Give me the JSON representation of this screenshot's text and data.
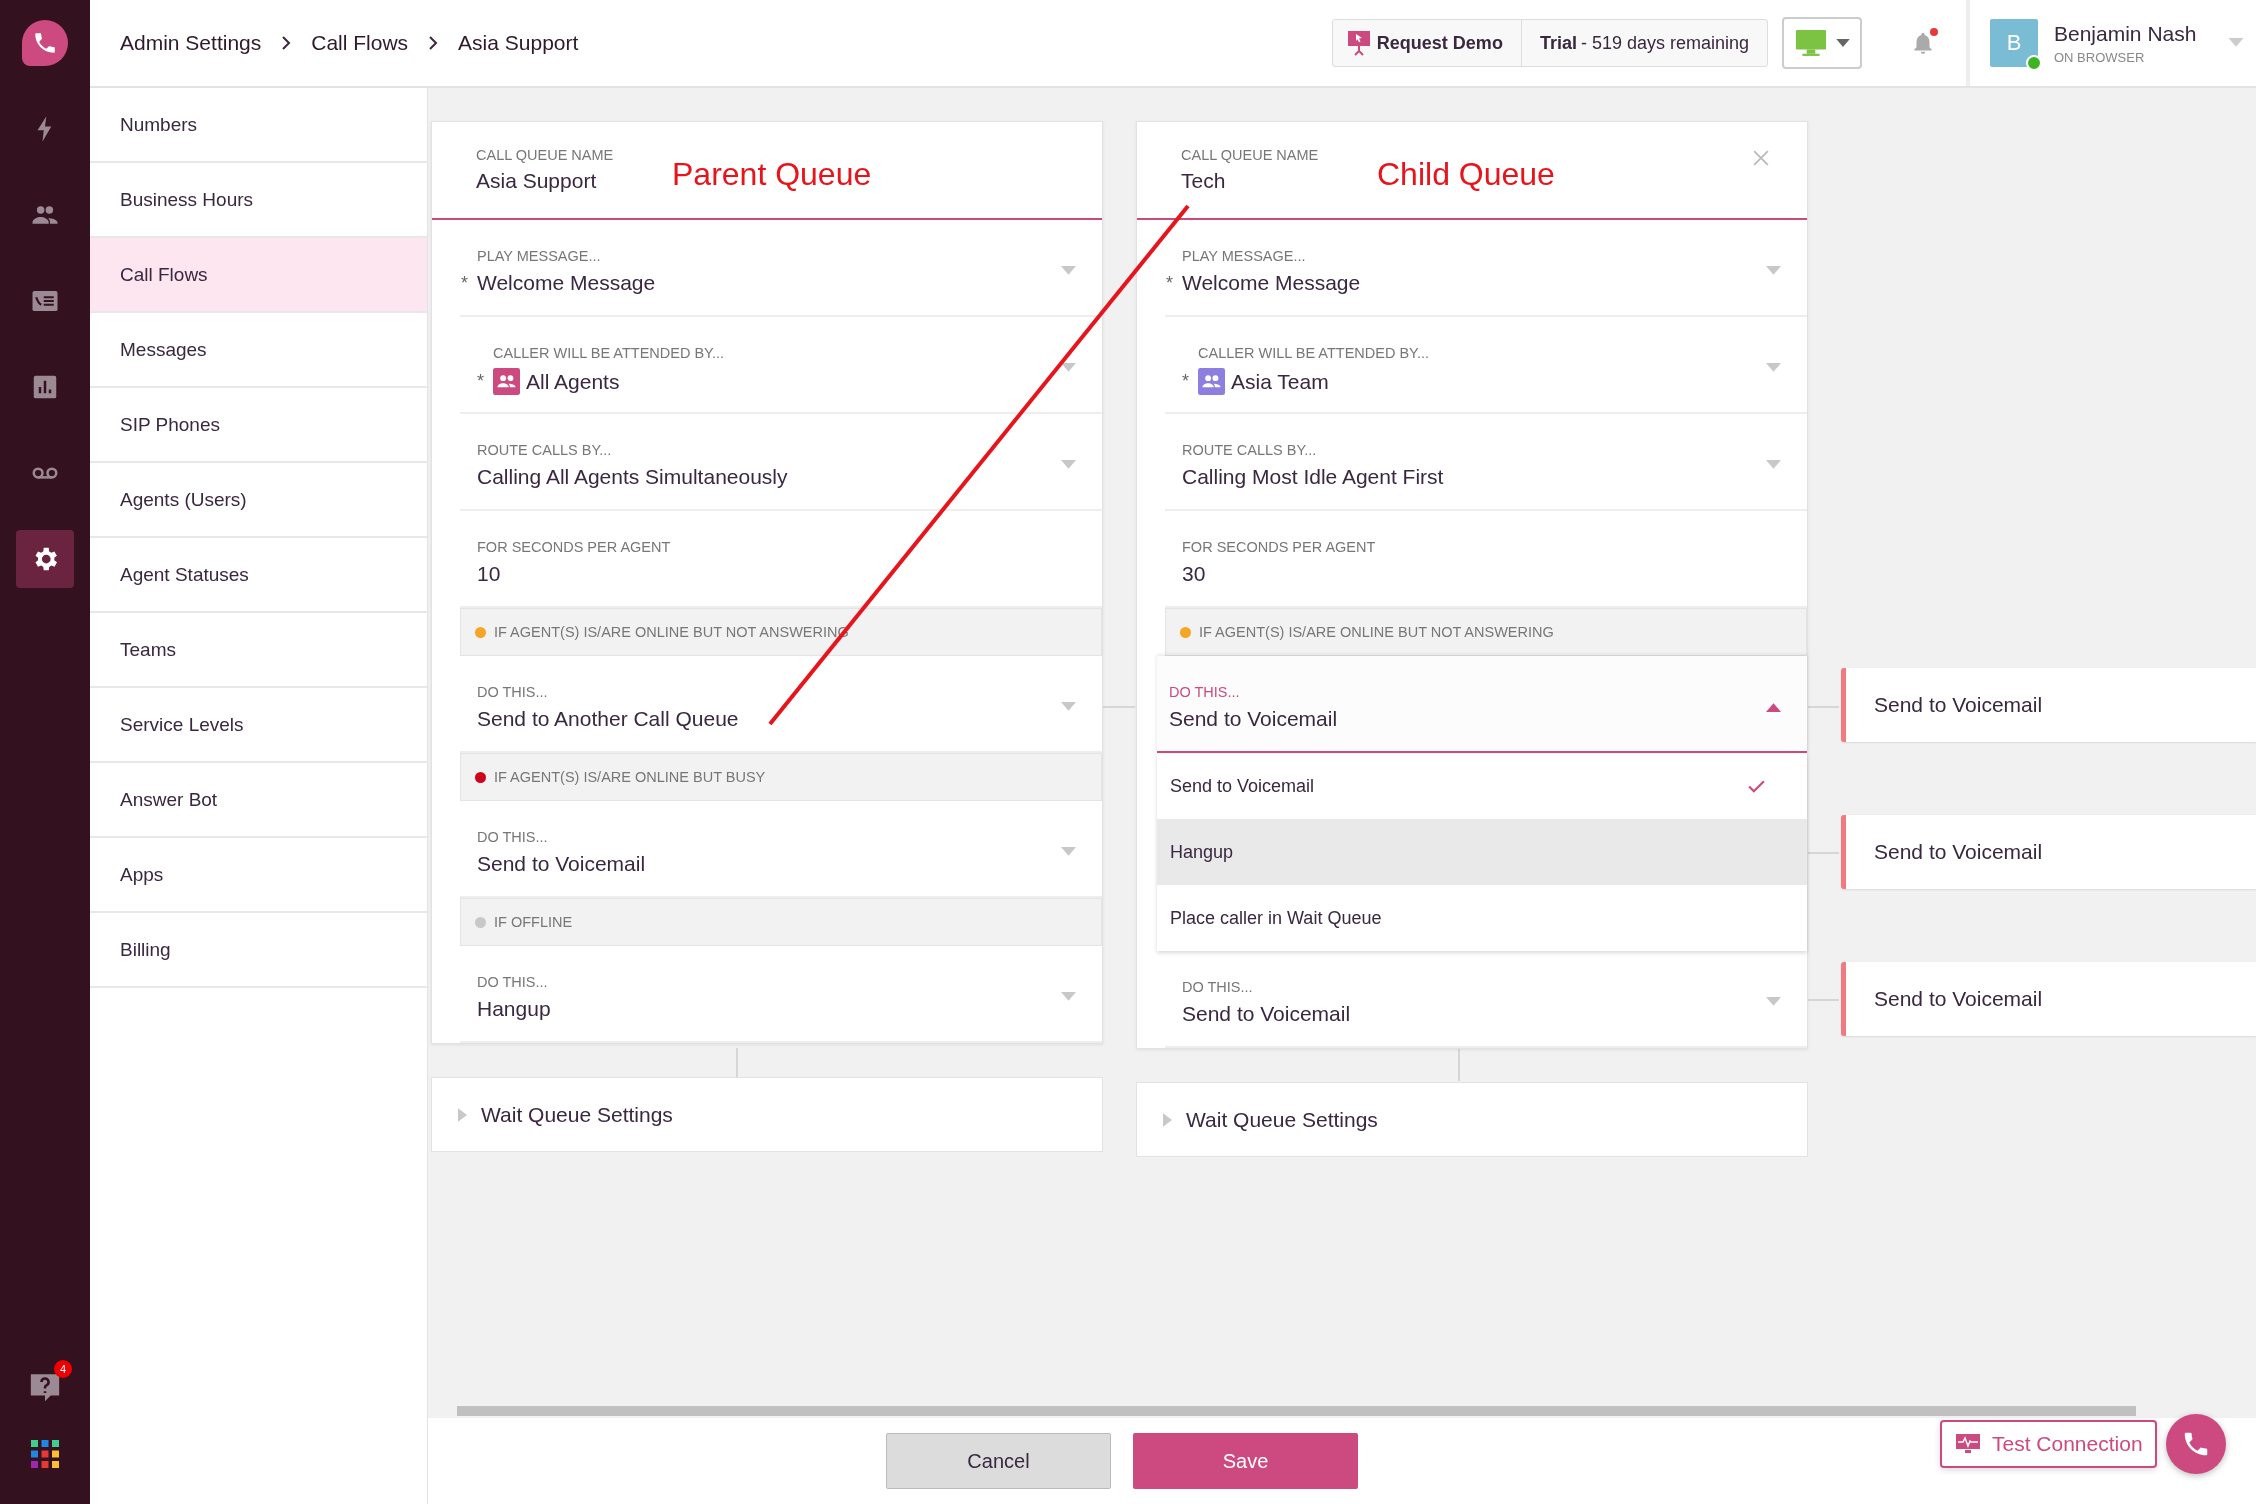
{
  "breadcrumb": [
    "Admin Settings",
    "Call Flows",
    "Asia Support"
  ],
  "header": {
    "request_demo": "Request Demo",
    "trial": "**Trial** - 519 days remaining",
    "notifications_unread": true,
    "user": {
      "initial": "B",
      "name": "Benjamin Nash",
      "status": "ON BROWSER",
      "online": true
    }
  },
  "rail": {
    "items": [
      {
        "selected": false
      },
      {
        "selected": false
      },
      {
        "selected": false
      },
      {
        "selected": false
      },
      {
        "selected": false
      },
      {
        "selected": true
      }
    ],
    "help_badge": "4"
  },
  "sidebar": {
    "items": [
      {
        "label": "Numbers",
        "selected": false
      },
      {
        "label": "Business Hours",
        "selected": false
      },
      {
        "label": "Call Flows",
        "selected": true
      },
      {
        "label": "Messages",
        "selected": false
      },
      {
        "label": "SIP Phones",
        "selected": false
      },
      {
        "label": "Agents (Users)",
        "selected": false
      },
      {
        "label": "Agent Statuses",
        "selected": false
      },
      {
        "label": "Teams",
        "selected": false
      },
      {
        "label": "Service Levels",
        "selected": false
      },
      {
        "label": "Answer Bot",
        "selected": false
      },
      {
        "label": "Apps",
        "selected": false
      },
      {
        "label": "Billing",
        "selected": false
      }
    ]
  },
  "queues": [
    {
      "name_label": "CALL QUEUE NAME",
      "name": "Asia Support",
      "annotation": "Parent Queue",
      "closable": false,
      "fields": [
        {
          "kind": "select",
          "label": "PLAY MESSAGE...",
          "value": "Welcome Message",
          "required_mark": "*",
          "expanded": false
        },
        {
          "kind": "team",
          "label": "CALLER WILL BE ATTENDED BY...",
          "value": "All Agents",
          "required_mark": "*",
          "expanded": false
        },
        {
          "kind": "select",
          "label": "ROUTE CALLS BY...",
          "value": "Calling All Agents Simultaneously",
          "expanded": false
        },
        {
          "kind": "text",
          "label": "FOR SECONDS PER AGENT",
          "value": "10"
        },
        {
          "kind": "section",
          "label": "IF AGENT(S) IS/ARE ONLINE BUT NOT ANSWERING",
          "color": "#f5a623"
        },
        {
          "kind": "select",
          "label": "DO THIS...",
          "value": "Send to Another Call Queue",
          "expanded": false
        },
        {
          "kind": "section",
          "label": "IF AGENT(S) IS/ARE ONLINE BUT BUSY",
          "color": "#d0021b"
        },
        {
          "kind": "select",
          "label": "DO THIS...",
          "value": "Send to Voicemail",
          "expanded": false
        },
        {
          "kind": "section",
          "label": "IF OFFLINE",
          "color": "#c8c8c8"
        },
        {
          "kind": "select",
          "label": "DO THIS...",
          "value": "Hangup",
          "expanded": false
        }
      ],
      "wait_queue": "Wait Queue Settings"
    },
    {
      "name_label": "CALL QUEUE NAME",
      "name": "Tech",
      "annotation": "Child Queue",
      "closable": true,
      "fields": [
        {
          "kind": "select",
          "label": "PLAY MESSAGE...",
          "value": "Welcome Message",
          "required_mark": "*",
          "expanded": false
        },
        {
          "kind": "team",
          "label": "CALLER WILL BE ATTENDED BY...",
          "value": "Asia Team",
          "required_mark": "*",
          "expanded": false
        },
        {
          "kind": "select",
          "label": "ROUTE CALLS BY...",
          "value": "Calling Most Idle Agent First",
          "expanded": false
        },
        {
          "kind": "text",
          "label": "FOR SECONDS PER AGENT",
          "value": "30"
        },
        {
          "kind": "section",
          "label": "IF AGENT(S) IS/ARE ONLINE BUT NOT ANSWERING",
          "color": "#f5a623"
        },
        {
          "kind": "select",
          "label": "DO THIS...",
          "value": "Send to Voicemail",
          "expanded": true,
          "options": [
            {
              "label": "Send to Voicemail",
              "selected": true,
              "hovered": false
            },
            {
              "label": "Hangup",
              "selected": false,
              "hovered": true
            },
            {
              "label": "Place caller in Wait Queue",
              "selected": false,
              "hovered": false
            }
          ]
        },
        {
          "kind": "select",
          "label": "DO THIS...",
          "value": "Send to Voicemail",
          "expanded": false
        }
      ],
      "wait_queue": "Wait Queue Settings"
    }
  ],
  "targets": [
    {
      "label": "Send to Voicemail"
    },
    {
      "label": "Send to Voicemail"
    },
    {
      "label": "Send to Voicemail"
    }
  ],
  "footer": {
    "cancel": "Cancel",
    "save": "Save",
    "test_connection": "Test Connection"
  }
}
